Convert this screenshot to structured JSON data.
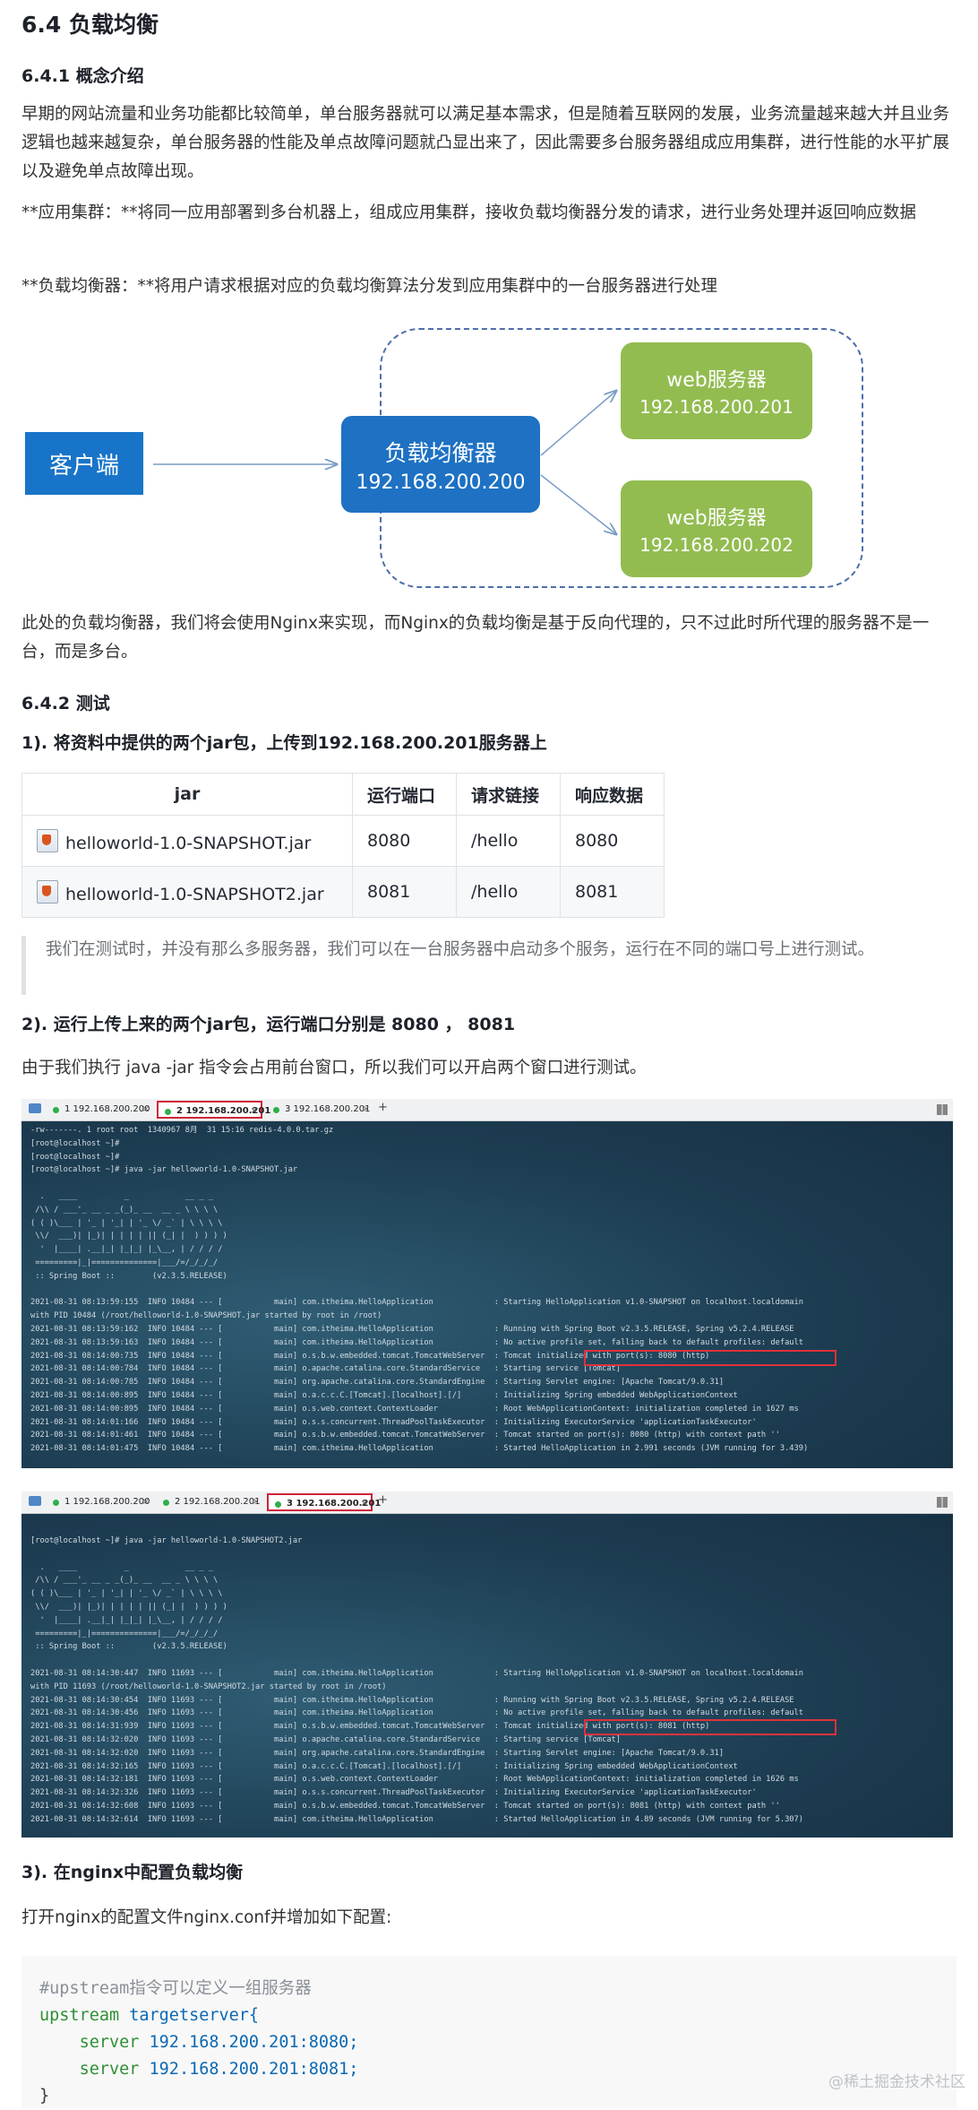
{
  "section": {
    "title": "6.4 负载均衡",
    "subtitle": "6.4.1 概念介绍"
  },
  "intro": {
    "paragraph": "早期的网站流量和业务功能都比较简单，单台服务器就可以满足基本需求，但是随着互联网的发展，业务流量越来越大并且业务逻辑也越来越复杂，单台服务器的性能及单点故障问题就凸显出来了，因此需要多台服务器组成应用集群，进行性能的水平扩展以及避免单点故障出现。",
    "app_cluster": "**应用集群：**将同一应用部署到多台机器上，组成应用集群，接收负载均衡器分发的请求，进行业务处理并返回响应数据",
    "load_balancer": "**负载均衡器：**将用户请求根据对应的负载均衡算法分发到应用集群中的一台服务器进行处理"
  },
  "diagram": {
    "client": "客户端",
    "lb_label": "负载均衡器",
    "lb_ip": "192.168.200.200",
    "web1_label": "web服务器",
    "web1_ip": "192.168.200.201",
    "web2_label": "web服务器",
    "web2_ip": "192.168.200.202"
  },
  "after_diagram": "此处的负载均衡器，我们将会使用Nginx来实现，而Nginx的负载均衡是基于反向代理的，只不过此时所代理的服务器不是一台，而是多台。",
  "test": {
    "heading": "6.4.2 测试",
    "step1": "1). 将资料中提供的两个jar包，上传到192.168.200.201服务器上",
    "table": {
      "headers": [
        "jar",
        "运行端口",
        "请求链接",
        "响应数据"
      ],
      "rows": [
        [
          "helloworld-1.0-SNAPSHOT.jar",
          "8080",
          "/hello",
          "8080"
        ],
        [
          "helloworld-1.0-SNAPSHOT2.jar",
          "8081",
          "/hello",
          "8081"
        ]
      ]
    },
    "quote": "我们在测试时，并没有那么多服务器，我们可以在一台服务器中启动多个服务，运行在不同的端口号上进行测试。",
    "step2": "2). 运行上传上来的两个jar包，运行端口分别是 8080 ， 8081",
    "step2_note": "由于我们执行 java -jar 指令会占用前台窗口，所以我们可以开启两个窗口进行测试。",
    "step3": "3). 在nginx中配置负载均衡",
    "step3_note": "打开nginx的配置文件nginx.conf并增加如下配置:"
  },
  "terminal1": {
    "tabs": [
      "1 192.168.200.200",
      "2 192.168.200.201",
      "3 192.168.200.201"
    ],
    "active_tab": 1,
    "log": "-rw-------. 1 root root  1340967 8月  31 15:16 redis-4.0.0.tar.gz\n[root@localhost ~]#\n[root@localhost ~]#\n[root@localhost ~]# java -jar helloworld-1.0-SNAPSHOT.jar\n\n  .   ____          _            __ _ _\n /\\\\ / ___'_ __ _ _(_)_ __  __ _ \\ \\ \\ \\\n( ( )\\___ | '_ | '_| | '_ \\/ _` | \\ \\ \\ \\\n \\\\/  ___)| |_)| | | | | || (_| |  ) ) ) )\n  '  |____| .__|_| |_|_| |_\\__, | / / / /\n =========|_|==============|___/=/_/_/_/\n :: Spring Boot ::        (v2.3.5.RELEASE)\n\n2021-08-31 08:13:59:155  INFO 10484 --- [           main] com.itheima.HelloApplication             : Starting HelloApplication v1.0-SNAPSHOT on localhost.localdomain\nwith PID 10484 (/root/helloworld-1.0-SNAPSHOT.jar started by root in /root)\n2021-08-31 08:13:59:162  INFO 10484 --- [           main] com.itheima.HelloApplication             : Running with Spring Boot v2.3.5.RELEASE, Spring v5.2.4.RELEASE\n2021-08-31 08:13:59:163  INFO 10484 --- [           main] com.itheima.HelloApplication             : No active profile set, falling back to default profiles: default\n2021-08-31 08:14:00:735  INFO 10484 --- [           main] o.s.b.w.embedded.tomcat.TomcatWebServer  : Tomcat initialized with port(s): 8080 (http)\n2021-08-31 08:14:00:784  INFO 10484 --- [           main] o.apache.catalina.core.StandardService   : Starting service [Tomcat]\n2021-08-31 08:14:00:785  INFO 10484 --- [           main] org.apache.catalina.core.StandardEngine  : Starting Servlet engine: [Apache Tomcat/9.0.31]\n2021-08-31 08:14:00:895  INFO 10484 --- [           main] o.a.c.c.C.[Tomcat].[localhost].[/]       : Initializing Spring embedded WebApplicationContext\n2021-08-31 08:14:00:895  INFO 10484 --- [           main] o.s.web.context.ContextLoader            : Root WebApplicationContext: initialization completed in 1627 ms\n2021-08-31 08:14:01:166  INFO 10484 --- [           main] o.s.s.concurrent.ThreadPoolTaskExecutor  : Initializing ExecutorService 'applicationTaskExecutor'\n2021-08-31 08:14:01:461  INFO 10484 --- [           main] o.s.b.w.embedded.tomcat.TomcatWebServer  : Tomcat started on port(s): 8080 (http) with context path ''\n2021-08-31 08:14:01:475  INFO 10484 --- [           main] com.itheima.HelloApplication             : Started HelloApplication in 2.991 seconds (JVM running for 3.439)"
  },
  "terminal2": {
    "tabs": [
      "1 192.168.200.200",
      "2 192.168.200.201",
      "3 192.168.200.201"
    ],
    "active_tab": 2,
    "log": "[root@localhost ~]# java -jar helloworld-1.0-SNAPSHOT2.jar\n\n  .   ____          _            __ _ _\n /\\\\ / ___'_ __ _ _(_)_ __  __ _ \\ \\ \\ \\\n( ( )\\___ | '_ | '_| | '_ \\/ _` | \\ \\ \\ \\\n \\\\/  ___)| |_)| | | | | || (_| |  ) ) ) )\n  '  |____| .__|_| |_|_| |_\\__, | / / / /\n =========|_|==============|___/=/_/_/_/\n :: Spring Boot ::        (v2.3.5.RELEASE)\n\n2021-08-31 08:14:30:447  INFO 11693 --- [           main] com.itheima.HelloApplication             : Starting HelloApplication v1.0-SNAPSHOT on localhost.localdomain\nwith PID 11693 (/root/helloworld-1.0-SNAPSHOT2.jar started by root in /root)\n2021-08-31 08:14:30:454  INFO 11693 --- [           main] com.itheima.HelloApplication             : Running with Spring Boot v2.3.5.RELEASE, Spring v5.2.4.RELEASE\n2021-08-31 08:14:30:456  INFO 11693 --- [           main] com.itheima.HelloApplication             : No active profile set, falling back to default profiles: default\n2021-08-31 08:14:31:939  INFO 11693 --- [           main] o.s.b.w.embedded.tomcat.TomcatWebServer  : Tomcat initialized with port(s): 8081 (http)\n2021-08-31 08:14:32:020  INFO 11693 --- [           main] o.apache.catalina.core.StandardService   : Starting service [Tomcat]\n2021-08-31 08:14:32:020  INFO 11693 --- [           main] org.apache.catalina.core.StandardEngine  : Starting Servlet engine: [Apache Tomcat/9.0.31]\n2021-08-31 08:14:32:165  INFO 11693 --- [           main] o.a.c.c.C.[Tomcat].[localhost].[/]       : Initializing Spring embedded WebApplicationContext\n2021-08-31 08:14:32:181  INFO 11693 --- [           main] o.s.web.context.ContextLoader            : Root WebApplicationContext: initialization completed in 1626 ms\n2021-08-31 08:14:32:326  INFO 11693 --- [           main] o.s.s.concurrent.ThreadPoolTaskExecutor  : Initializing ExecutorService 'applicationTaskExecutor'\n2021-08-31 08:14:32:608  INFO 11693 --- [           main] o.s.b.w.embedded.tomcat.TomcatWebServer  : Tomcat started on port(s): 8081 (http) with context path ''\n2021-08-31 08:14:32:614  INFO 11693 --- [           main] com.itheima.HelloApplication             : Started HelloApplication in 4.89 seconds (JVM running for 5.307)"
  },
  "code": {
    "comment": "#upstream指令可以定义一组服务器",
    "line1_kw": "upstream",
    "line1_name": "targetserver{",
    "line2_kw": "server",
    "line2_val": "192.168.200.201:8080;",
    "line3_kw": "server",
    "line3_val": "192.168.200.201:8081;",
    "line4": "}"
  },
  "watermark": "@稀土掘金技术社区"
}
